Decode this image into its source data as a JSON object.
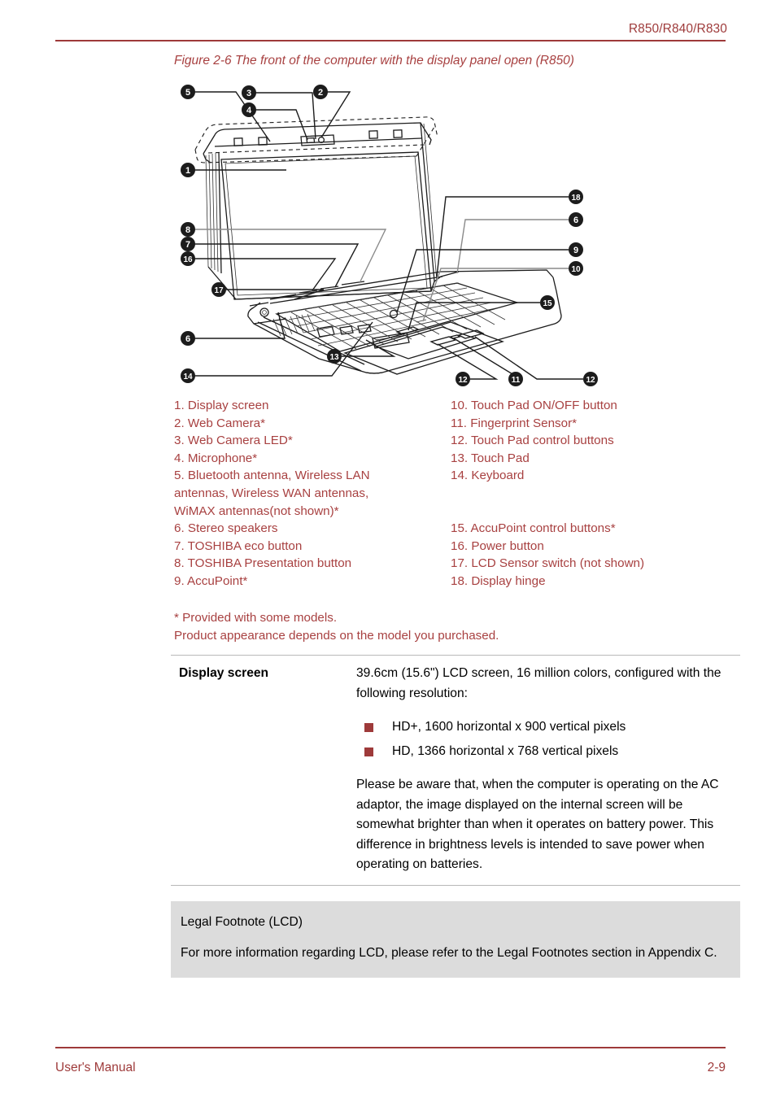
{
  "header": {
    "model_line": "R850/R840/R830",
    "accent_color": "#9e3a3a"
  },
  "figure": {
    "caption": "Figure 2-6 The front of the computer with the display panel open (R850)",
    "alt": "Line drawing of a laptop computer seen from the front with the display panel open, numbered callouts 1 through 18",
    "callouts": [
      "1",
      "2",
      "3",
      "4",
      "5",
      "6",
      "7",
      "8",
      "9",
      "10",
      "11",
      "12",
      "13",
      "14",
      "15",
      "16",
      "17",
      "18"
    ]
  },
  "legend": {
    "left": [
      "1. Display screen",
      "2. Web Camera*",
      "3. Web Camera LED*",
      "4. Microphone*",
      "5. Bluetooth antenna, Wireless LAN\nantennas, Wireless WAN antennas,\nWiMAX antennas(not shown)*",
      "6. Stereo speakers",
      "7. TOSHIBA eco button",
      "8. TOSHIBA Presentation button",
      "9. AccuPoint*"
    ],
    "right_top": [
      "10. Touch Pad ON/OFF button",
      "11. Fingerprint Sensor*",
      "12. Touch Pad control buttons",
      "13. Touch Pad",
      "14. Keyboard"
    ],
    "right_bottom": [
      "15. AccuPoint control buttons*",
      "16. Power button",
      "17. LCD Sensor switch (not shown)",
      "18. Display hinge"
    ]
  },
  "figure_footnotes": [
    "* Provided with some models.",
    "Product appearance depends on the model you purchased."
  ],
  "spec": {
    "label": "Display screen",
    "intro": "39.6cm (15.6\") LCD screen, 16 million colors, configured with the following resolution:",
    "bullets": [
      "HD+, 1600 horizontal x 900 vertical pixels",
      "HD, 1366 horizontal x 768 vertical pixels"
    ],
    "note": "Please be aware that, when the computer is operating on the AC adaptor, the image displayed on the internal screen will be somewhat brighter than when it operates on battery power. This difference in brightness levels is intended to save power when operating on batteries.",
    "bullet_color": "#9e3a3a"
  },
  "legal_footnote": {
    "title": "Legal Footnote (LCD)",
    "body": "For more information regarding LCD, please refer to the Legal Footnotes section in Appendix C.",
    "background_color": "#dcdcdc"
  },
  "footer": {
    "left": "User's Manual",
    "right": "2-9"
  }
}
